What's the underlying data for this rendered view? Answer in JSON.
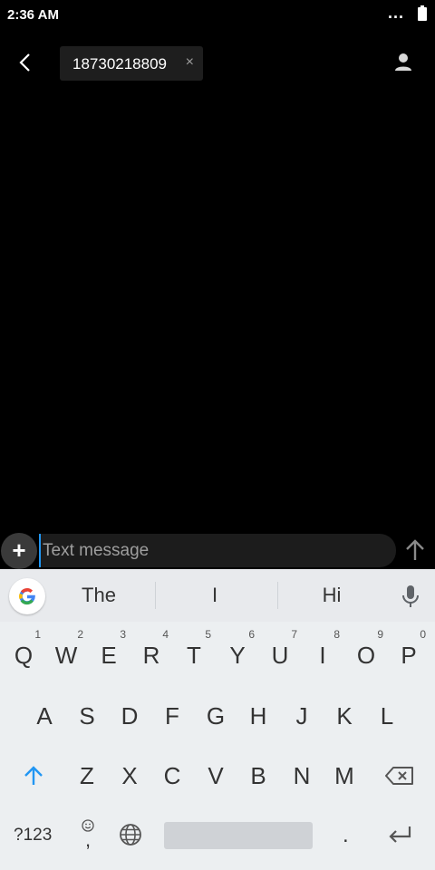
{
  "status_bar": {
    "time": "2:36 AM",
    "overflow": "..."
  },
  "header": {
    "recipient": "18730218809",
    "remove_label": "×"
  },
  "compose": {
    "placeholder": "Text message",
    "add_label": "+"
  },
  "suggestions": [
    "The",
    "I",
    "Hi"
  ],
  "keyboard": {
    "row1": [
      {
        "k": "Q",
        "n": "1"
      },
      {
        "k": "W",
        "n": "2"
      },
      {
        "k": "E",
        "n": "3"
      },
      {
        "k": "R",
        "n": "4"
      },
      {
        "k": "T",
        "n": "5"
      },
      {
        "k": "Y",
        "n": "6"
      },
      {
        "k": "U",
        "n": "7"
      },
      {
        "k": "I",
        "n": "8"
      },
      {
        "k": "O",
        "n": "9"
      },
      {
        "k": "P",
        "n": "0"
      }
    ],
    "row2": [
      "A",
      "S",
      "D",
      "F",
      "G",
      "H",
      "J",
      "K",
      "L"
    ],
    "row3": [
      "Z",
      "X",
      "C",
      "V",
      "B",
      "N",
      "M"
    ],
    "symbols_label": "?123",
    "comma_label": ",",
    "period_label": "."
  },
  "colors": {
    "accent": "#2196f3",
    "background": "#000000",
    "keyboard_bg": "#eceff1"
  }
}
